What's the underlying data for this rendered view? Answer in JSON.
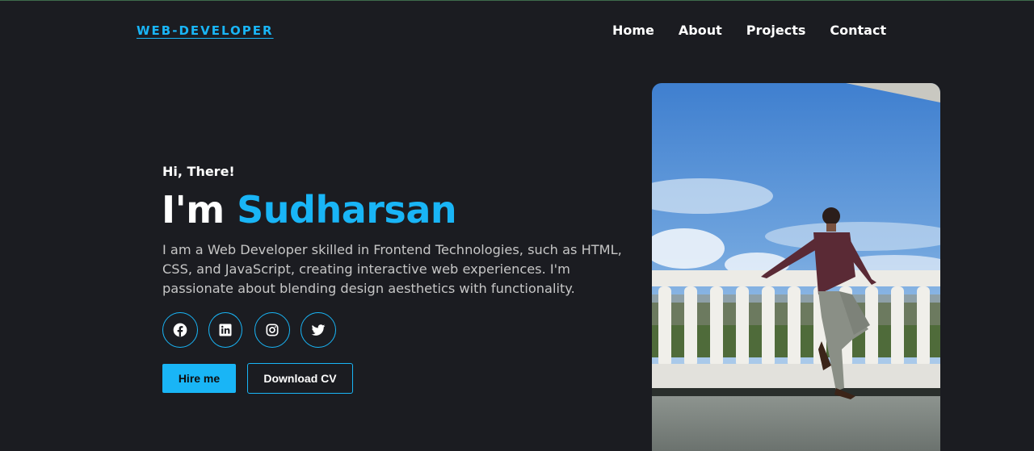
{
  "header": {
    "logo": "WEB-DEVELOPER",
    "nav": [
      "Home",
      "About",
      "Projects",
      "Contact"
    ]
  },
  "hero": {
    "greeting": "Hi, There!",
    "intro_prefix": "I'm ",
    "name": "Sudharsan",
    "description": "I am a Web Developer skilled in Frontend Technologies, such as HTML, CSS, and JavaScript, creating interactive web experiences. I'm passionate about blending design aesthetics with functionality.",
    "socials": [
      "facebook-icon",
      "linkedin-icon",
      "instagram-icon",
      "twitter-icon"
    ],
    "buttons": {
      "hire": "Hire me",
      "cv": "Download CV"
    }
  },
  "colors": {
    "accent": "#19b5f6",
    "background": "#1b1c21",
    "text": "#ffffff",
    "muted": "#c6c6c6"
  }
}
